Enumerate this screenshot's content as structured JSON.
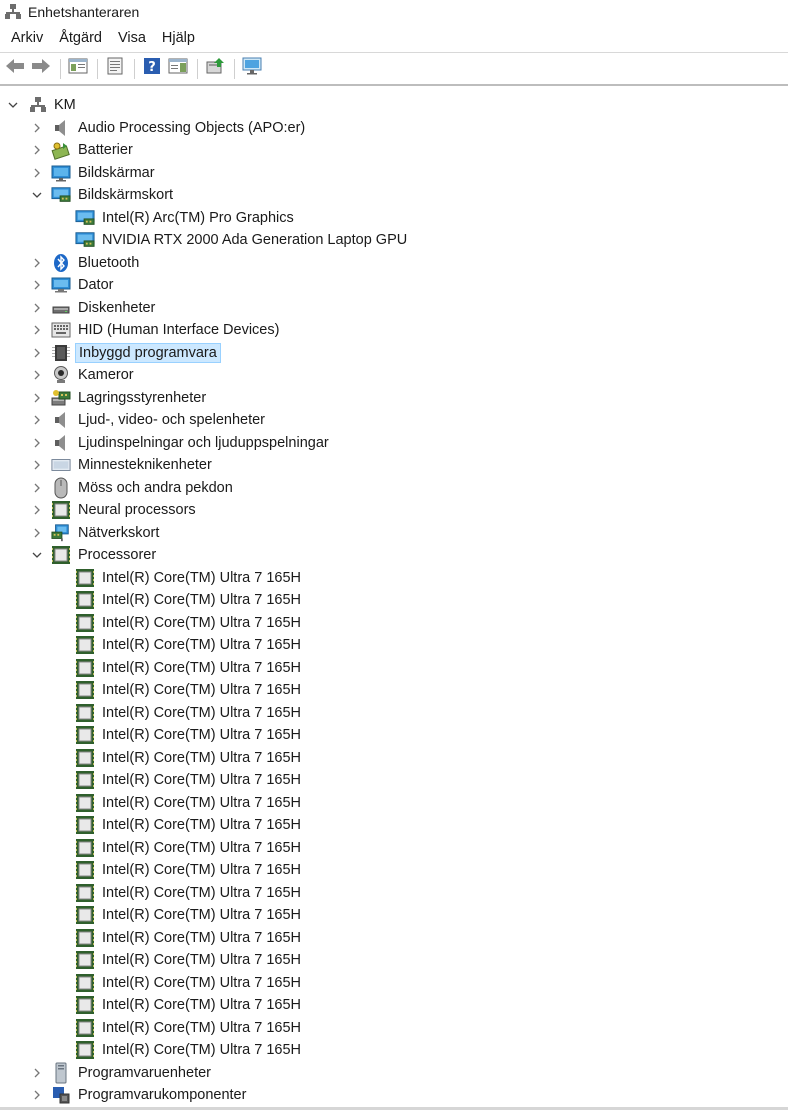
{
  "window": {
    "title": "Enhetshanteraren"
  },
  "menu": [
    "Arkiv",
    "Åtgärd",
    "Visa",
    "Hjälp"
  ],
  "toolbar": [
    {
      "name": "back-arrow-icon"
    },
    {
      "name": "forward-arrow-icon"
    },
    {
      "sep": true
    },
    {
      "name": "console-tree-icon"
    },
    {
      "sep": true
    },
    {
      "name": "properties-icon"
    },
    {
      "sep": true
    },
    {
      "name": "help-icon"
    },
    {
      "name": "action-pane-icon"
    },
    {
      "sep": true
    },
    {
      "name": "update-driver-icon"
    },
    {
      "sep": true
    },
    {
      "name": "scan-hardware-icon"
    }
  ],
  "tree": [
    {
      "label": "KM",
      "level": 0,
      "state": "expanded",
      "icon": "computer-root-icon"
    },
    {
      "label": "Audio Processing Objects (APO:er)",
      "level": 1,
      "state": "collapsed",
      "icon": "speaker-icon"
    },
    {
      "label": "Batterier",
      "level": 1,
      "state": "collapsed",
      "icon": "battery-icon"
    },
    {
      "label": "Bildskärmar",
      "level": 1,
      "state": "collapsed",
      "icon": "monitor-icon"
    },
    {
      "label": "Bildskärmskort",
      "level": 1,
      "state": "expanded",
      "icon": "display-adapter-icon"
    },
    {
      "label": "Intel(R) Arc(TM) Pro Graphics",
      "level": 2,
      "state": "leaf",
      "icon": "display-adapter-icon"
    },
    {
      "label": "NVIDIA RTX 2000 Ada Generation Laptop GPU",
      "level": 2,
      "state": "leaf",
      "icon": "display-adapter-icon"
    },
    {
      "label": "Bluetooth",
      "level": 1,
      "state": "collapsed",
      "icon": "bluetooth-icon"
    },
    {
      "label": "Dator",
      "level": 1,
      "state": "collapsed",
      "icon": "computer-icon"
    },
    {
      "label": "Diskenheter",
      "level": 1,
      "state": "collapsed",
      "icon": "disk-drive-icon"
    },
    {
      "label": "HID (Human Interface Devices)",
      "level": 1,
      "state": "collapsed",
      "icon": "hid-icon"
    },
    {
      "label": "Inbyggd programvara",
      "level": 1,
      "state": "collapsed",
      "icon": "firmware-icon",
      "selected": true
    },
    {
      "label": "Kameror",
      "level": 1,
      "state": "collapsed",
      "icon": "camera-icon"
    },
    {
      "label": "Lagringsstyrenheter",
      "level": 1,
      "state": "collapsed",
      "icon": "storage-controller-icon"
    },
    {
      "label": "Ljud-, video- och spelenheter",
      "level": 1,
      "state": "collapsed",
      "icon": "speaker-icon"
    },
    {
      "label": "Ljudinspelningar och ljuduppspelningar",
      "level": 1,
      "state": "collapsed",
      "icon": "speaker-icon"
    },
    {
      "label": "Minnesteknikenheter",
      "level": 1,
      "state": "collapsed",
      "icon": "memory-icon"
    },
    {
      "label": "Möss och andra pekdon",
      "level": 1,
      "state": "collapsed",
      "icon": "mouse-icon"
    },
    {
      "label": "Neural processors",
      "level": 1,
      "state": "collapsed",
      "icon": "chip-icon"
    },
    {
      "label": "Nätverkskort",
      "level": 1,
      "state": "collapsed",
      "icon": "network-adapter-icon"
    },
    {
      "label": "Processorer",
      "level": 1,
      "state": "expanded",
      "icon": "chip-icon"
    },
    {
      "label": "Intel(R) Core(TM) Ultra 7 165H",
      "level": 2,
      "state": "leaf",
      "icon": "chip-icon"
    },
    {
      "label": "Intel(R) Core(TM) Ultra 7 165H",
      "level": 2,
      "state": "leaf",
      "icon": "chip-icon"
    },
    {
      "label": "Intel(R) Core(TM) Ultra 7 165H",
      "level": 2,
      "state": "leaf",
      "icon": "chip-icon"
    },
    {
      "label": "Intel(R) Core(TM) Ultra 7 165H",
      "level": 2,
      "state": "leaf",
      "icon": "chip-icon"
    },
    {
      "label": "Intel(R) Core(TM) Ultra 7 165H",
      "level": 2,
      "state": "leaf",
      "icon": "chip-icon"
    },
    {
      "label": "Intel(R) Core(TM) Ultra 7 165H",
      "level": 2,
      "state": "leaf",
      "icon": "chip-icon"
    },
    {
      "label": "Intel(R) Core(TM) Ultra 7 165H",
      "level": 2,
      "state": "leaf",
      "icon": "chip-icon"
    },
    {
      "label": "Intel(R) Core(TM) Ultra 7 165H",
      "level": 2,
      "state": "leaf",
      "icon": "chip-icon"
    },
    {
      "label": "Intel(R) Core(TM) Ultra 7 165H",
      "level": 2,
      "state": "leaf",
      "icon": "chip-icon"
    },
    {
      "label": "Intel(R) Core(TM) Ultra 7 165H",
      "level": 2,
      "state": "leaf",
      "icon": "chip-icon"
    },
    {
      "label": "Intel(R) Core(TM) Ultra 7 165H",
      "level": 2,
      "state": "leaf",
      "icon": "chip-icon"
    },
    {
      "label": "Intel(R) Core(TM) Ultra 7 165H",
      "level": 2,
      "state": "leaf",
      "icon": "chip-icon"
    },
    {
      "label": "Intel(R) Core(TM) Ultra 7 165H",
      "level": 2,
      "state": "leaf",
      "icon": "chip-icon"
    },
    {
      "label": "Intel(R) Core(TM) Ultra 7 165H",
      "level": 2,
      "state": "leaf",
      "icon": "chip-icon"
    },
    {
      "label": "Intel(R) Core(TM) Ultra 7 165H",
      "level": 2,
      "state": "leaf",
      "icon": "chip-icon"
    },
    {
      "label": "Intel(R) Core(TM) Ultra 7 165H",
      "level": 2,
      "state": "leaf",
      "icon": "chip-icon"
    },
    {
      "label": "Intel(R) Core(TM) Ultra 7 165H",
      "level": 2,
      "state": "leaf",
      "icon": "chip-icon"
    },
    {
      "label": "Intel(R) Core(TM) Ultra 7 165H",
      "level": 2,
      "state": "leaf",
      "icon": "chip-icon"
    },
    {
      "label": "Intel(R) Core(TM) Ultra 7 165H",
      "level": 2,
      "state": "leaf",
      "icon": "chip-icon"
    },
    {
      "label": "Intel(R) Core(TM) Ultra 7 165H",
      "level": 2,
      "state": "leaf",
      "icon": "chip-icon"
    },
    {
      "label": "Intel(R) Core(TM) Ultra 7 165H",
      "level": 2,
      "state": "leaf",
      "icon": "chip-icon"
    },
    {
      "label": "Intel(R) Core(TM) Ultra 7 165H",
      "level": 2,
      "state": "leaf",
      "icon": "chip-icon"
    },
    {
      "label": "Programvaruenheter",
      "level": 1,
      "state": "collapsed",
      "icon": "software-device-icon"
    },
    {
      "label": "Programvarukomponenter",
      "level": 1,
      "state": "collapsed",
      "icon": "software-component-icon"
    }
  ]
}
